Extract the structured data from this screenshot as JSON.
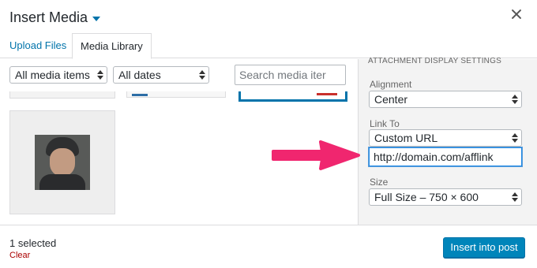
{
  "header": {
    "title": "Insert Media"
  },
  "tabs": [
    {
      "label": "Upload Files"
    },
    {
      "label": "Media Library"
    }
  ],
  "toolbar": {
    "media_filter": "All media items",
    "date_filter": "All dates",
    "search_placeholder": "Search media iter"
  },
  "grid": {
    "selected_count_text": "1 selected",
    "clear_label": "Clear"
  },
  "attachment_settings": {
    "heading": "ATTACHMENT DISPLAY SETTINGS",
    "alignment_label": "Alignment",
    "alignment_value": "Center",
    "link_to_label": "Link To",
    "link_to_value": "Custom URL",
    "url_value": "http://domain.com/afflink",
    "size_label": "Size",
    "size_value": "Full Size – 750 × 600"
  },
  "footer": {
    "insert_label": "Insert into post"
  },
  "colors": {
    "accent": "#0073aa",
    "button": "#0085ba",
    "annotation_arrow": "#f0266f",
    "clear_link": "#aa0000"
  },
  "icons": [
    "dropdown-caret-icon",
    "close-icon",
    "select-caret-icon"
  ]
}
